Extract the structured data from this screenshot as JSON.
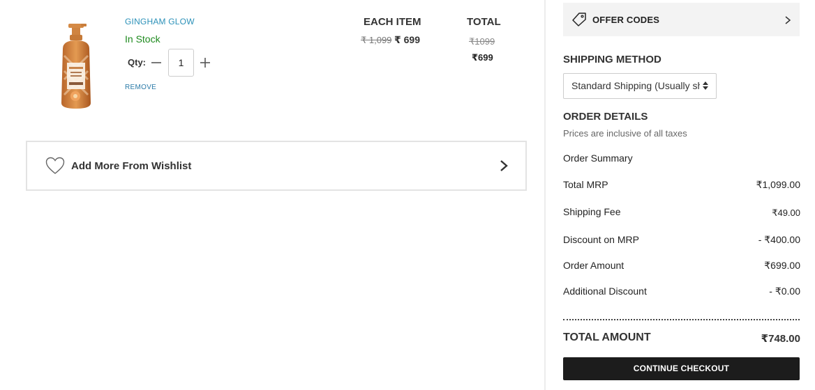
{
  "cart_item": {
    "image_icon": "foaming-soap-bottle-icon",
    "name": "GINGHAM GLOW",
    "stock_status": "In Stock",
    "qty_label": "Qty:",
    "qty_value": "1",
    "remove_label": "REMOVE",
    "each_item_header": "EACH ITEM",
    "total_header": "TOTAL",
    "each_price_original": "₹ 1,099",
    "each_price_sale": "₹ 699",
    "total_original": "₹1099",
    "total_sale": "₹699"
  },
  "wishlist": {
    "label": "Add More From Wishlist",
    "icon": "heart-icon"
  },
  "offer": {
    "label": "OFFER CODES",
    "icon": "tag-icon"
  },
  "shipping": {
    "title": "SHIPPING METHOD",
    "selected": "Standard Shipping (Usually shi"
  },
  "order": {
    "title": "ORDER DETAILS",
    "subtitle": "Prices are inclusive of all taxes",
    "summary_heading": "Order Summary",
    "rows": [
      {
        "label": "Total MRP",
        "value": "₹1,099.00"
      },
      {
        "label": "Shipping Fee",
        "value": "₹49.00"
      },
      {
        "label": "Discount on MRP",
        "value": "- ₹400.00"
      },
      {
        "label": "Order Amount",
        "value": "₹699.00"
      },
      {
        "label": "Additional Discount",
        "value": "- ₹0.00"
      }
    ],
    "total_label": "TOTAL AMOUNT",
    "total_value": "₹748.00"
  },
  "checkout": {
    "label": "CONTINUE CHECKOUT"
  },
  "colors": {
    "link_blue": "#2a90b8",
    "in_stock_green": "#1e8a1e",
    "checkout_bg": "#1c1c1c",
    "offer_bg": "#f3f3f3"
  }
}
